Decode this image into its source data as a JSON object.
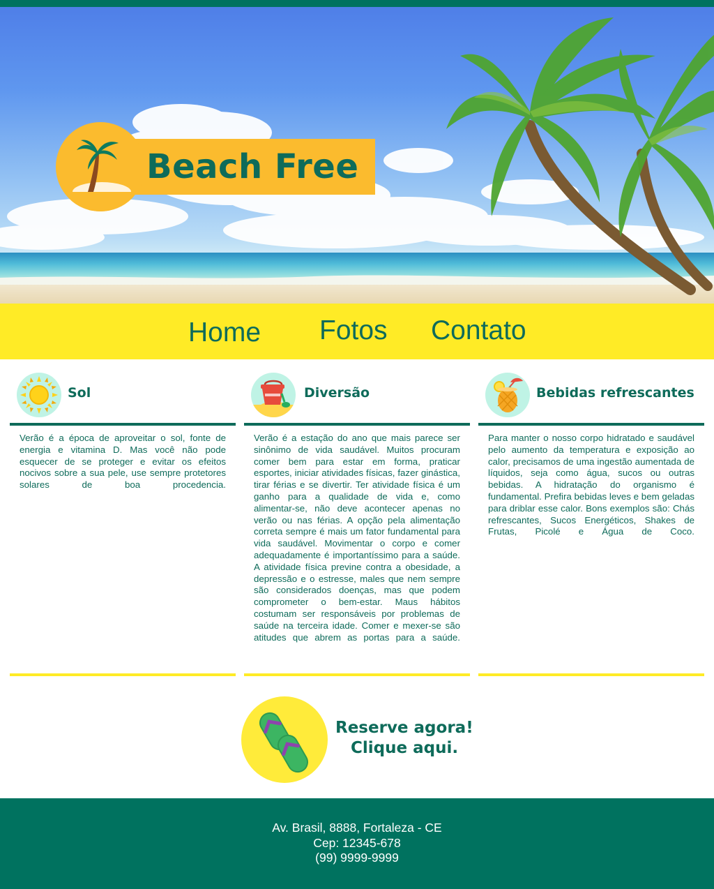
{
  "brand": {
    "title": "Beach Free",
    "logo_icon": "palm-island-icon"
  },
  "colors": {
    "teal": "#0e6b5a",
    "footer": "#00725f",
    "yellow": "#ffeb26",
    "logo_orange": "#fbbb2e"
  },
  "nav": {
    "items": [
      "Home",
      "Fotos",
      "Contato"
    ]
  },
  "columns": [
    {
      "title": "Sol",
      "icon": "sun-icon",
      "text": "Verão é a época de aproveitar o sol, fonte de energia e vitamina D. Mas você não pode esquecer de se proteger e evitar os efeitos nocivos sobre a sua pele, use sempre protetores solares de boa procedencia."
    },
    {
      "title": "Diversão",
      "icon": "sand-bucket-icon",
      "text": "Verão é a estação do ano que mais parece ser sinônimo de vida saudável. Muitos procuram comer bem para estar em forma, praticar esportes, iniciar atividades físicas, fazer ginástica, tirar férias e se divertir. Ter atividade física é um ganho para a qualidade de vida e, como alimentar-se, não deve acontecer apenas no verão ou nas férias. A opção pela alimentação correta sempre é mais um fator fundamental para vida saudável. Movimentar o corpo e comer adequadamente é importantíssimo para a saúde. A atividade física previne contra a obesidade, a depressão e o estresse, males que nem sempre são considerados doenças, mas que podem comprometer o bem-estar. Maus hábitos costumam ser responsáveis por problemas de saúde na terceira idade. Comer e mexer-se são atitudes que abrem as portas para a saúde."
    },
    {
      "title": "Bebidas refrescantes",
      "icon": "pineapple-drink-icon",
      "text": "Para manter o nosso corpo hidratado e saudável pelo aumento da temperatura e exposição ao calor, precisamos de uma ingestão aumentada de líquidos, seja como água, sucos ou outras bebidas. A hidratação do organismo é fundamental. Prefira bebidas leves e bem geladas para driblar esse calor. Bons exemplos são: Chás refrescantes, Sucos Energéticos, Shakes de Frutas, Picolé e Água de Coco."
    }
  ],
  "cta": {
    "line1": "Reserve agora!",
    "line2": "Clique aqui.",
    "icon": "flip-flops-icon"
  },
  "footer": {
    "address": "Av. Brasil, 8888, Fortaleza - CE",
    "cep": "Cep: 12345-678",
    "phone": "(99) 9999-9999"
  }
}
